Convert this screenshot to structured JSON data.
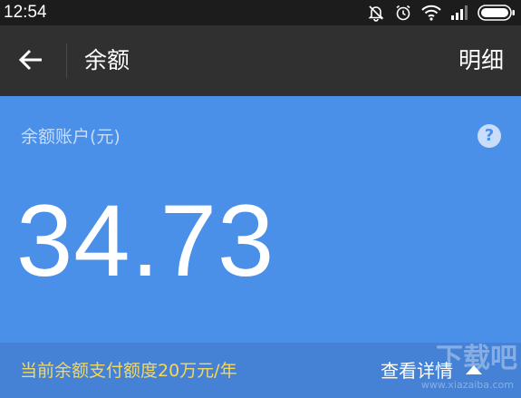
{
  "status_bar": {
    "time": "12:54",
    "icons": [
      "alarm-off-icon",
      "alarm-clock-icon",
      "wifi-icon",
      "signal-icon",
      "battery-icon"
    ]
  },
  "action_bar": {
    "back_icon": "arrow-left-icon",
    "title": "余额",
    "detail_label": "明细"
  },
  "balance": {
    "account_label": "余额账户(元)",
    "help_icon": "question-icon",
    "amount": "34.73"
  },
  "footer": {
    "limit_text": "当前余额支付额度20万元/年",
    "view_details_label": "查看详情",
    "view_details_icon": "triangle-up-icon"
  },
  "watermark": {
    "text": "下载吧",
    "sub": "www.xiazaiba.com"
  },
  "colors": {
    "status_bar_bg": "#1c1c1c",
    "action_bar_bg": "#303030",
    "card_bg": "#4a8fe8",
    "footer_bg": "#4582d6",
    "limit_text": "#f5d75a",
    "label_text": "#c9ddf8"
  }
}
